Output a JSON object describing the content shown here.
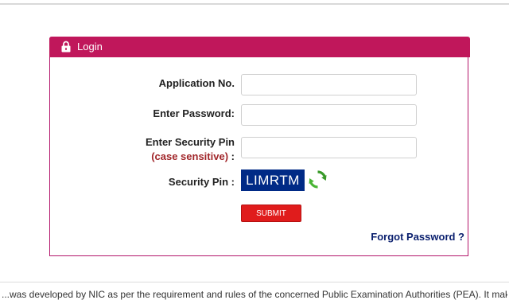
{
  "panel": {
    "title": "Login",
    "icon": "lock-icon"
  },
  "form": {
    "application_no_label": "Application No.",
    "application_no_value": "",
    "password_label": "Enter Password:",
    "password_value": "",
    "security_pin_label": "Enter Security Pin",
    "security_pin_note": "(case sensitive)",
    "security_pin_colon": ":",
    "security_pin_value": "",
    "captcha_label": "Security Pin :",
    "captcha_text": "LIMRTM",
    "refresh_icon": "refresh-icon",
    "submit_label": "SUBMIT",
    "forgot_password_label": "Forgot Password ?"
  },
  "footer": {
    "text": "...was developed by NIC as per the requirement and rules of the concerned Public Examination Authorities (PEA). It makes use of"
  },
  "colors": {
    "header_bg": "#c0175b",
    "panel_border": "#b3166b",
    "captcha_bg": "#002a86",
    "submit_bg": "#e01c1c",
    "link": "#0a1f6e",
    "note": "#a1262a"
  }
}
